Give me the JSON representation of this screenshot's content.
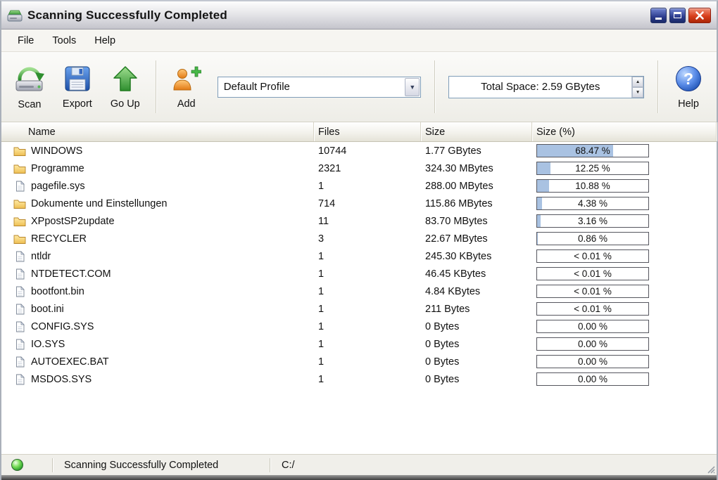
{
  "window": {
    "title": "Scanning Successfully Completed"
  },
  "menu": {
    "items": [
      "File",
      "Tools",
      "Help"
    ]
  },
  "toolbar": {
    "buttons": {
      "scan": "Scan",
      "export": "Export",
      "go_up": "Go Up",
      "add": "Add",
      "help": "Help"
    },
    "profile_dropdown": {
      "value": "Default Profile"
    },
    "total_space_field": {
      "value": "Total Space: 2.59 GBytes"
    }
  },
  "icons": {
    "combo_arrow": "▼",
    "spin_up": "▲",
    "spin_down": "▼"
  },
  "table": {
    "columns": [
      "Name",
      "Files",
      "Size",
      "Size (%)"
    ],
    "rows": [
      {
        "name": "WINDOWS",
        "type": "folder",
        "files": "10744",
        "size": "1.77 GBytes",
        "percent_label": "68.47 %",
        "percent": 68.47
      },
      {
        "name": "Programme",
        "type": "folder",
        "files": "2321",
        "size": "324.30 MBytes",
        "percent_label": "12.25 %",
        "percent": 12.25
      },
      {
        "name": "pagefile.sys",
        "type": "file",
        "files": "1",
        "size": "288.00 MBytes",
        "percent_label": "10.88 %",
        "percent": 10.88
      },
      {
        "name": "Dokumente und Einstellungen",
        "type": "folder",
        "files": "714",
        "size": "115.86 MBytes",
        "percent_label": "4.38 %",
        "percent": 4.38
      },
      {
        "name": "XPpostSP2update",
        "type": "folder",
        "files": "11",
        "size": "83.70 MBytes",
        "percent_label": "3.16 %",
        "percent": 3.16
      },
      {
        "name": "RECYCLER",
        "type": "folder",
        "files": "3",
        "size": "22.67 MBytes",
        "percent_label": "0.86 %",
        "percent": 0.86
      },
      {
        "name": "ntldr",
        "type": "file",
        "files": "1",
        "size": "245.30 KBytes",
        "percent_label": "< 0.01 %",
        "percent": 0
      },
      {
        "name": "NTDETECT.COM",
        "type": "file",
        "files": "1",
        "size": "46.45 KBytes",
        "percent_label": "< 0.01 %",
        "percent": 0
      },
      {
        "name": "bootfont.bin",
        "type": "file",
        "files": "1",
        "size": "4.84 KBytes",
        "percent_label": "< 0.01 %",
        "percent": 0
      },
      {
        "name": "boot.ini",
        "type": "file",
        "files": "1",
        "size": "211 Bytes",
        "percent_label": "< 0.01 %",
        "percent": 0
      },
      {
        "name": "CONFIG.SYS",
        "type": "file",
        "files": "1",
        "size": "0 Bytes",
        "percent_label": "0.00 %",
        "percent": 0
      },
      {
        "name": "IO.SYS",
        "type": "file",
        "files": "1",
        "size": "0 Bytes",
        "percent_label": "0.00 %",
        "percent": 0
      },
      {
        "name": "AUTOEXEC.BAT",
        "type": "file",
        "files": "1",
        "size": "0 Bytes",
        "percent_label": "0.00 %",
        "percent": 0
      },
      {
        "name": "MSDOS.SYS",
        "type": "file",
        "files": "1",
        "size": "0 Bytes",
        "percent_label": "0.00 %",
        "percent": 0
      }
    ]
  },
  "statusbar": {
    "status": "Scanning Successfully Completed",
    "path": "C:/"
  },
  "colors": {
    "bar_fill": "#a9c2e2",
    "accent_green": "#3c9a3c",
    "header_bg": "#e5e3d8"
  }
}
